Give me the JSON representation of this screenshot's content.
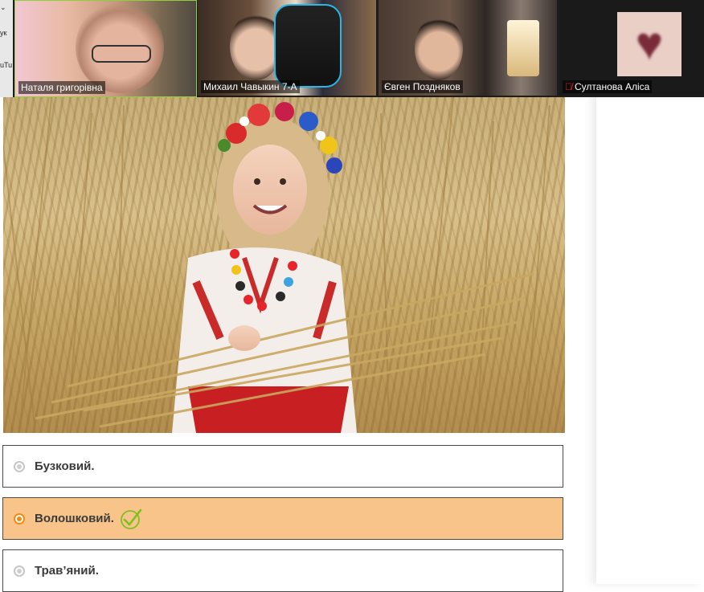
{
  "left_edge": {
    "text1": "ук",
    "text2": "uTu"
  },
  "participants": [
    {
      "name": "Наталя григорівна",
      "active_speaker": true
    },
    {
      "name": "Михаил Чавыкин 7-А",
      "active_speaker": false
    },
    {
      "name": "Євген Поздняков",
      "active_speaker": false
    },
    {
      "name": "Султанова Аліса",
      "active_speaker": false,
      "muted": true,
      "avatar_icon": "heart-icon"
    }
  ],
  "quiz": {
    "options": [
      {
        "label": "Бузковий.",
        "selected": false
      },
      {
        "label": "Волошковий.",
        "selected": true,
        "correct_icon": "checkmark-icon"
      },
      {
        "label": "Трав’яний.",
        "selected": false
      }
    ]
  },
  "colors": {
    "selected_bg": "#f9c48a",
    "radio_selected": "#f38a12",
    "active_speaker_border": "#8fce3c",
    "check_green": "#7fbf1f"
  }
}
